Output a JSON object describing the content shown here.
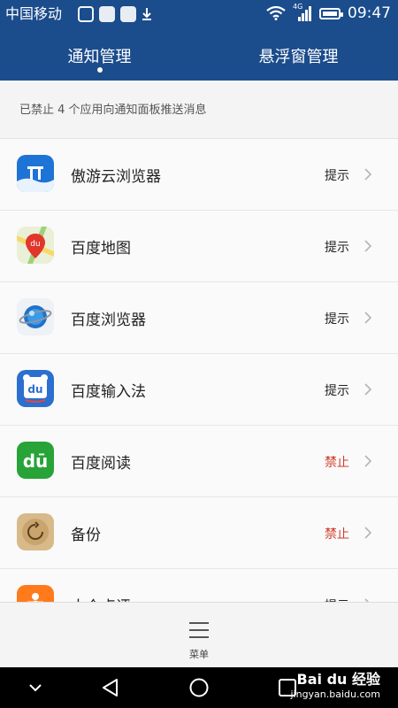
{
  "statusbar": {
    "carrier": "中国移动",
    "network": "4G",
    "time": "09:47"
  },
  "tabs": [
    {
      "label": "通知管理",
      "active": true
    },
    {
      "label": "悬浮窗管理",
      "active": false
    }
  ],
  "notice": "已禁止 4 个应用向通知面板推送消息",
  "apps": [
    {
      "name": "傲游云浏览器",
      "status": "提示",
      "icon": "maxthon-icon"
    },
    {
      "name": "百度地图",
      "status": "提示",
      "icon": "baidu-map-icon"
    },
    {
      "name": "百度浏览器",
      "status": "提示",
      "icon": "baidu-browser-icon"
    },
    {
      "name": "百度输入法",
      "status": "提示",
      "icon": "baidu-input-icon"
    },
    {
      "name": "百度阅读",
      "status": "禁止",
      "icon": "baidu-read-icon"
    },
    {
      "name": "备份",
      "status": "禁止",
      "icon": "backup-icon"
    },
    {
      "name": "大众点评",
      "status": "提示",
      "icon": "dianping-icon"
    }
  ],
  "bottom": {
    "menu_label": "菜单"
  },
  "watermark": {
    "brand": "Bai du 经验",
    "url": "jingyan.baidu.com"
  },
  "colors": {
    "header": "#1b4c8c",
    "ban": "#d23a2a",
    "allow": "#222222"
  }
}
